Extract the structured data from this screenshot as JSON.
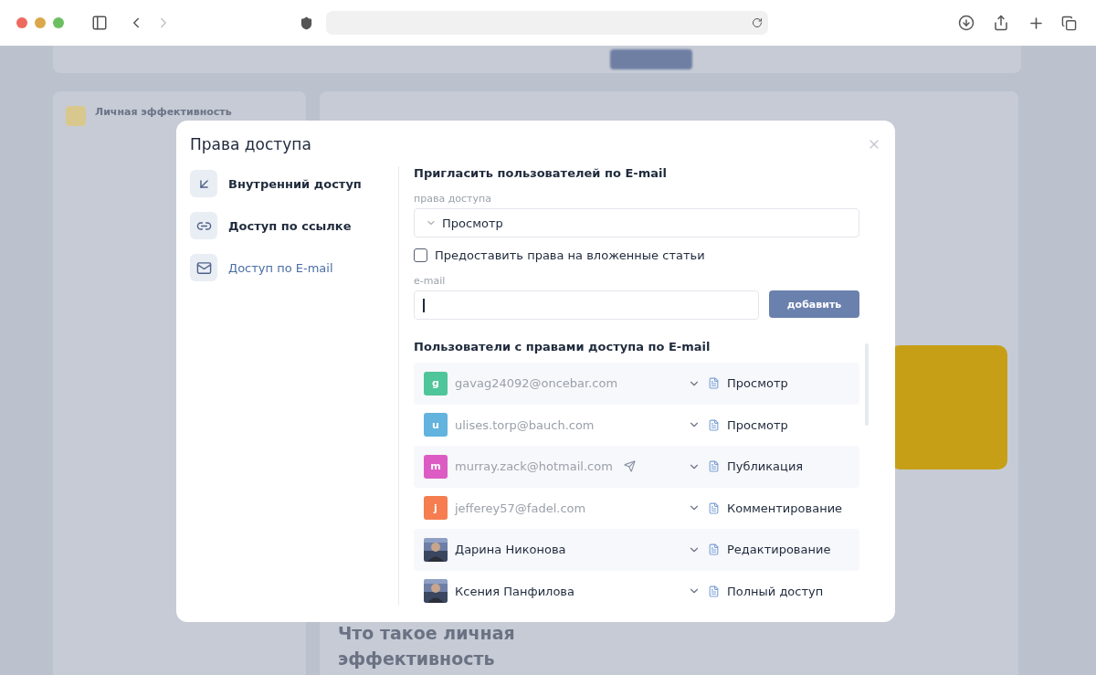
{
  "background": {
    "sidebar_title": "Личная эффективность",
    "article_heading": "Что такое личная эффективность"
  },
  "dialog": {
    "title": "Права доступа",
    "nav": [
      {
        "label": "Внутренний доступ",
        "selected": false
      },
      {
        "label": "Доступ по ссылке",
        "selected": false
      },
      {
        "label": "Доступ по E-mail",
        "selected": true
      }
    ],
    "invite": {
      "title": "Пригласить пользователей по E-mail",
      "rights_label": "права доступа",
      "rights_value": "Просмотр",
      "nested_label": "Предоставить права на вложенные статьи",
      "nested_checked": false,
      "email_label": "e-mail",
      "add_button": "добавить"
    },
    "users_title": "Пользователи с правами доступа по E-mail",
    "users": [
      {
        "name": "gavag24092@oncebar.com",
        "avatar": {
          "kind": "letter",
          "letter": "g",
          "color": "#4fc59a"
        },
        "pending": true,
        "resend": false,
        "role": "Просмотр"
      },
      {
        "name": "ulises.torp@bauch.com",
        "avatar": {
          "kind": "letter",
          "letter": "u",
          "color": "#62b3de"
        },
        "pending": true,
        "resend": false,
        "role": "Просмотр"
      },
      {
        "name": "murray.zack@hotmail.com",
        "avatar": {
          "kind": "letter",
          "letter": "m",
          "color": "#dc5cc4"
        },
        "pending": true,
        "resend": true,
        "role": "Публикация"
      },
      {
        "name": "jefferey57@fadel.com",
        "avatar": {
          "kind": "letter",
          "letter": "j",
          "color": "#f57d50"
        },
        "pending": true,
        "resend": false,
        "role": "Комментирование"
      },
      {
        "name": "Дарина Никонова",
        "pending": false,
        "resend": false,
        "role": "Редактирование"
      },
      {
        "name": "Ксения Панфилова",
        "pending": false,
        "resend": false,
        "role": "Полный доступ"
      }
    ]
  }
}
